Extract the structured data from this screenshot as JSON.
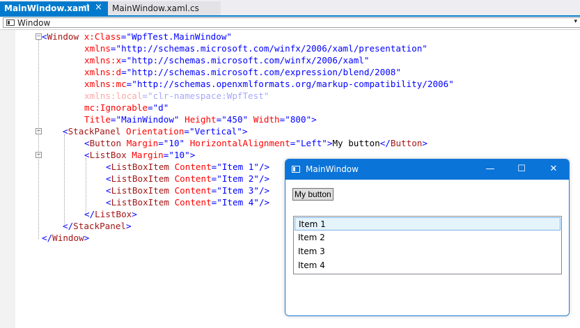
{
  "tabs": [
    {
      "label": "MainWindow.xaml",
      "active": true,
      "pin": "⊣",
      "close": "×"
    },
    {
      "label": "MainWindow.xaml.cs",
      "active": false
    }
  ],
  "navbar": {
    "selected": "Window",
    "dropdown_glyph": "▾"
  },
  "code": {
    "l1": {
      "lt": "<",
      "tag": "Window",
      "attr": "x:Class",
      "eq": "=",
      "val": "\"WpfTest.MainWindow\""
    },
    "l2": {
      "attr": "xmlns",
      "eq": "=",
      "val": "\"http://schemas.microsoft.com/winfx/2006/xaml/presentation\""
    },
    "l3": {
      "attr": "xmlns:x",
      "eq": "=",
      "val": "\"http://schemas.microsoft.com/winfx/2006/xaml\""
    },
    "l4": {
      "attr": "xmlns:d",
      "eq": "=",
      "val": "\"http://schemas.microsoft.com/expression/blend/2008\""
    },
    "l5": {
      "attr": "xmlns:mc",
      "eq": "=",
      "val": "\"http://schemas.openxmlformats.org/markup-compatibility/2006\""
    },
    "l6": {
      "attr": "xmlns:local",
      "eq": "=",
      "val": "\"clr-namespace:WpfTest\""
    },
    "l7": {
      "attr": "mc:Ignorable",
      "eq": "=",
      "val": "\"d\""
    },
    "l8": {
      "attr1": "Title",
      "eq1": "=",
      "val1": "\"MainWindow\"",
      "attr2": "Height",
      "eq2": "=",
      "val2": "\"450\"",
      "attr3": "Width",
      "eq3": "=",
      "val3": "\"800\"",
      "gt": ">"
    },
    "l9": {
      "lt": "<",
      "tag": "StackPanel",
      "attr": "Orientation",
      "eq": "=",
      "val": "\"Vertical\"",
      "gt": ">"
    },
    "l10": {
      "lt": "<",
      "tag": "Button",
      "attr1": "Margin",
      "eq1": "=",
      "val1": "\"10\"",
      "attr2": "HorizontalAlignment",
      "eq2": "=",
      "val2": "\"Left\"",
      "gt": ">",
      "text": "My button",
      "close_lt": "</",
      "close_tag": "Button",
      "close_gt": ">"
    },
    "l11": {
      "lt": "<",
      "tag": "ListBox",
      "attr": "Margin",
      "eq": "=",
      "val": "\"10\"",
      "gt": ">"
    },
    "items": [
      {
        "lt": "<",
        "tag": "ListBoxItem",
        "attr": "Content",
        "eq": "=",
        "val": "\"Item 1\"",
        "end": "/>"
      },
      {
        "lt": "<",
        "tag": "ListBoxItem",
        "attr": "Content",
        "eq": "=",
        "val": "\"Item 2\"",
        "end": "/>"
      },
      {
        "lt": "<",
        "tag": "ListBoxItem",
        "attr": "Content",
        "eq": "=",
        "val": "\"Item 3\"",
        "end": "/>"
      },
      {
        "lt": "<",
        "tag": "ListBoxItem",
        "attr": "Content",
        "eq": "=",
        "val": "\"Item 4\"",
        "end": "/>"
      }
    ],
    "l16": {
      "lt": "</",
      "tag": "ListBox",
      "gt": ">"
    },
    "l17": {
      "lt": "</",
      "tag": "StackPanel",
      "gt": ">"
    },
    "l18": {
      "lt": "</",
      "tag": "Window",
      "gt": ">"
    }
  },
  "window": {
    "title": "MainWindow",
    "minimize": "—",
    "maximize": "☐",
    "close": "✕",
    "button_label": "My button",
    "list_items": [
      "Item 1",
      "Item 2",
      "Item 3",
      "Item 4"
    ]
  },
  "colors": {
    "accent": "#007acc",
    "tag": "#a31515",
    "attr": "#ff0000",
    "value": "#0000ff",
    "titlebar": "#0b74d9"
  }
}
